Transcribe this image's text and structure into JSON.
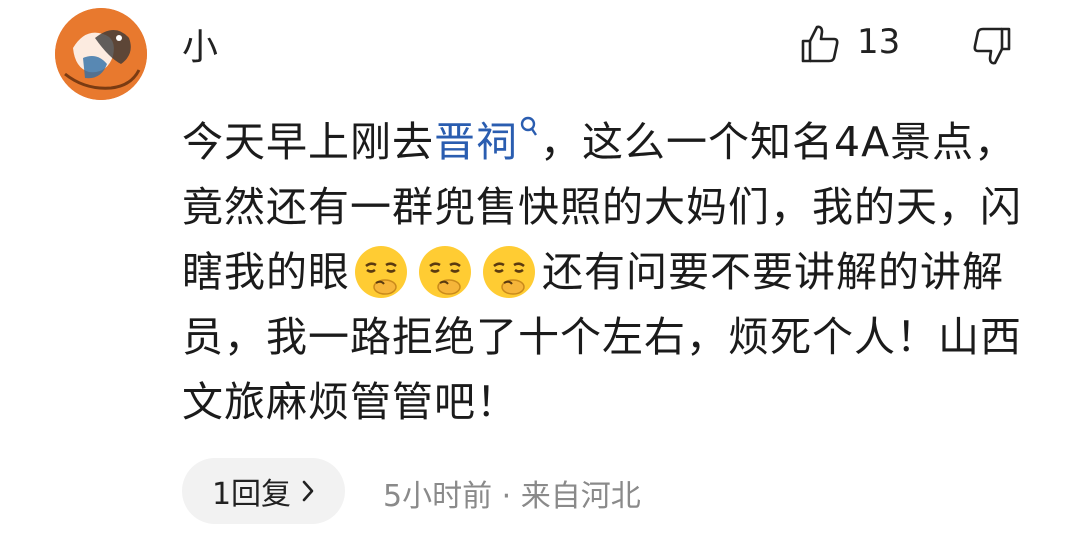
{
  "user": {
    "name": "小 ",
    "avatar": "orange-bird-illustration"
  },
  "actions": {
    "like_count": "13",
    "like_icon": "thumb-up-icon",
    "dislike_icon": "thumb-down-icon"
  },
  "comment": {
    "part1": "今天早上刚去",
    "link": "晋祠",
    "part2": "，这么一个知名4A景点，竟然还有一群兜售快照的大妈们，我的天，闪瞎我的眼",
    "emoji": "shushing-face-emoji",
    "part3": "还有问要不要讲解的讲解员，我一路拒绝了十个左右，烦死个人！山西文旅麻烦管管吧！"
  },
  "footer": {
    "reply_label": "1回复",
    "meta": "5小时前 · 来自河北"
  }
}
